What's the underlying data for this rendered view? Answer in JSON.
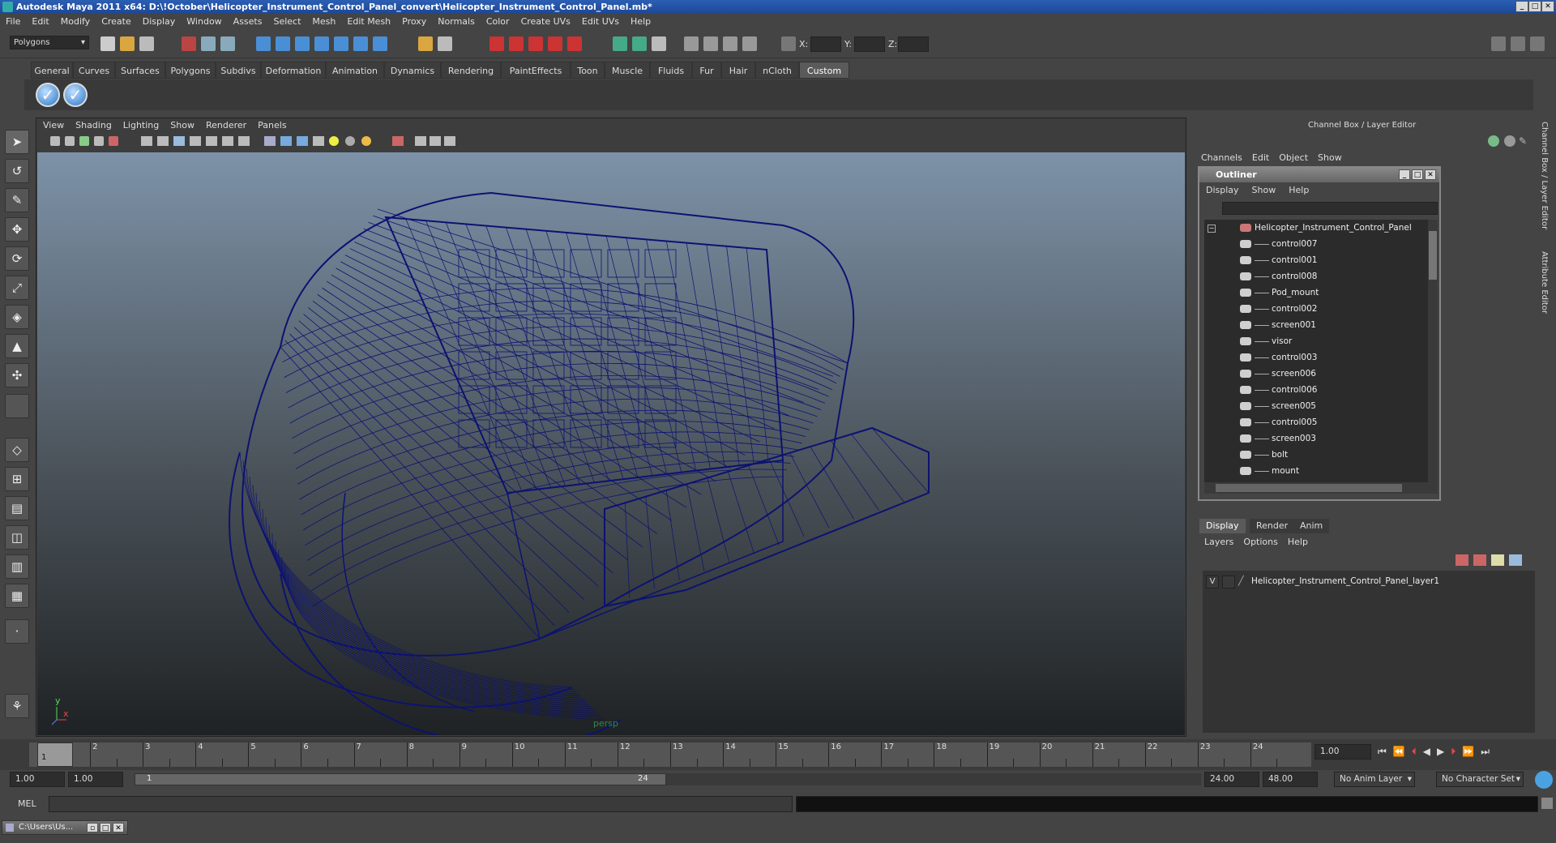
{
  "window": {
    "title": "Autodesk Maya 2011 x64: D:\\!October\\Helicopter_Instrument_Control_Panel_convert\\Helicopter_Instrument_Control_Panel.mb*"
  },
  "menus": [
    "File",
    "Edit",
    "Modify",
    "Create",
    "Display",
    "Window",
    "Assets",
    "Select",
    "Mesh",
    "Edit Mesh",
    "Proxy",
    "Normals",
    "Color",
    "Create UVs",
    "Edit UVs",
    "Help"
  ],
  "status": {
    "mode": "Polygons",
    "x_label": "X:",
    "y_label": "Y:",
    "z_label": "Z:"
  },
  "shelf": {
    "tabs": [
      "General",
      "Curves",
      "Surfaces",
      "Polygons",
      "Subdivs",
      "Deformation",
      "Animation",
      "Dynamics",
      "Rendering",
      "PaintEffects",
      "Toon",
      "Muscle",
      "Fluids",
      "Fur",
      "Hair",
      "nCloth",
      "Custom"
    ],
    "active": "Custom"
  },
  "viewport": {
    "menus": [
      "View",
      "Shading",
      "Lighting",
      "Show",
      "Renderer",
      "Panels"
    ],
    "camera": "persp",
    "axis_y": "y",
    "axis_x": "x",
    "wire_color": "#0c1272"
  },
  "channel_box": {
    "title": "Channel Box / Layer Editor",
    "menus": [
      "Channels",
      "Edit",
      "Object",
      "Show"
    ]
  },
  "side_tabs": [
    "Channel Box / Layer Editor",
    "Attribute Editor"
  ],
  "outliner": {
    "title": "Outliner",
    "menus": [
      "Display",
      "Show",
      "Help"
    ],
    "root": "Helicopter_Instrument_Control_Panel",
    "items": [
      "control007",
      "control001",
      "control008",
      "Pod_mount",
      "control002",
      "screen001",
      "visor",
      "control003",
      "screen006",
      "control006",
      "screen005",
      "control005",
      "screen003",
      "bolt",
      "mount"
    ]
  },
  "layer_editor": {
    "tabs": [
      "Display",
      "Render",
      "Anim"
    ],
    "active_tab": "Display",
    "menus": [
      "Layers",
      "Options",
      "Help"
    ],
    "layers": [
      {
        "visible": "V",
        "name": "Helicopter_Instrument_Control_Panel_layer1"
      }
    ]
  },
  "timeline": {
    "ticks": [
      "1",
      "2",
      "3",
      "4",
      "5",
      "6",
      "7",
      "8",
      "9",
      "10",
      "11",
      "12",
      "13",
      "14",
      "15",
      "16",
      "17",
      "18",
      "19",
      "20",
      "21",
      "22",
      "23",
      "24"
    ],
    "current_frame_marker": "1",
    "current_time": "1.00"
  },
  "range": {
    "start": "1.00",
    "playback_start": "1.00",
    "slider_start": "1",
    "slider_end": "24",
    "playback_end": "24.00",
    "end": "48.00",
    "anim_layer": "No Anim Layer",
    "character_set": "No Character Set"
  },
  "command_line": {
    "label": "MEL"
  },
  "taskbar": {
    "item": "C:\\Users\\Us..."
  }
}
